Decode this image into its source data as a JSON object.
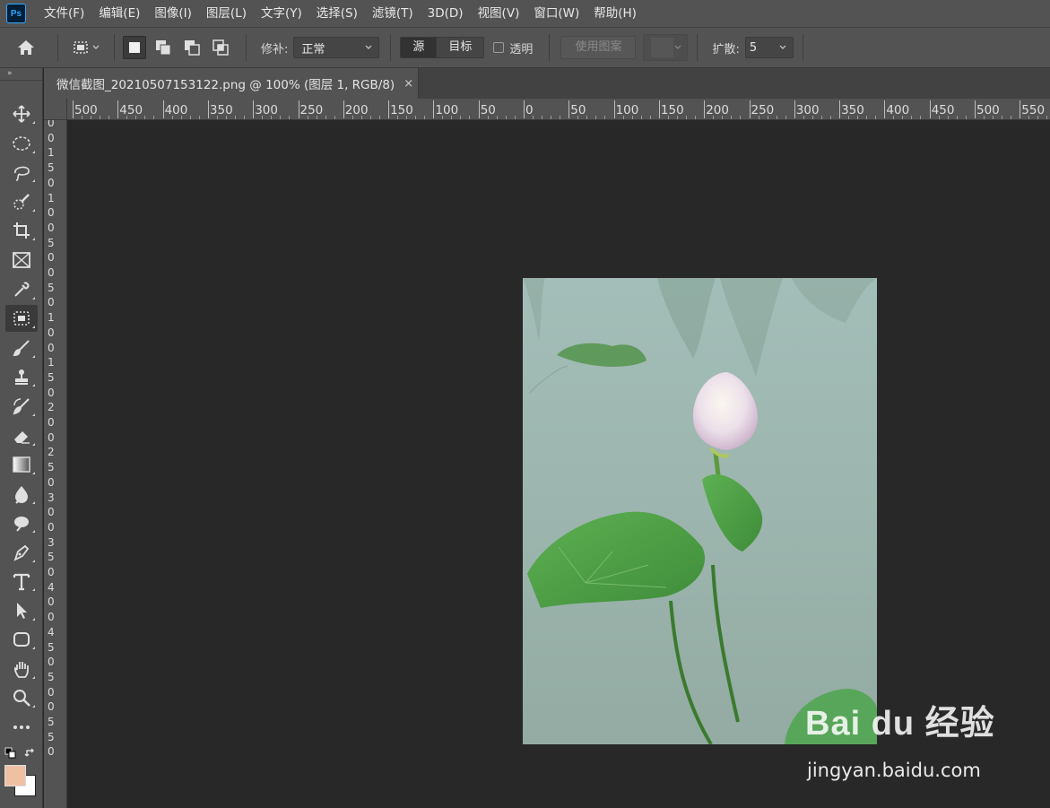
{
  "menubar": {
    "logo": "Ps",
    "items": [
      "文件(F)",
      "编辑(E)",
      "图像(I)",
      "图层(L)",
      "文字(Y)",
      "选择(S)",
      "滤镜(T)",
      "3D(D)",
      "视图(V)",
      "窗口(W)",
      "帮助(H)"
    ]
  },
  "options": {
    "patch_label": "修补:",
    "patch_mode": "正常",
    "source_label": "源",
    "target_label": "目标",
    "transparent_label": "透明",
    "use_pattern_label": "使用图案",
    "diffusion_label": "扩散:",
    "diffusion_value": "5"
  },
  "document": {
    "tab_title": "微信截图_20210507153122.png @ 100% (图层 1, RGB/8)",
    "close_symbol": "×"
  },
  "ruler": {
    "horizontal": [
      "500",
      "450",
      "400",
      "350",
      "300",
      "250",
      "200",
      "150",
      "100",
      "50",
      "0",
      "50",
      "100",
      "150",
      "200",
      "250",
      "300",
      "350",
      "400",
      "450",
      "500",
      "550"
    ],
    "vertical": [
      "0",
      "0",
      "1",
      "5",
      "0",
      "1",
      "0",
      "0",
      "5",
      "0",
      "0",
      "5",
      "0",
      "1",
      "0",
      "0",
      "1",
      "5",
      "0",
      "2",
      "0",
      "0",
      "2",
      "5",
      "0",
      "3",
      "0",
      "0",
      "3",
      "5",
      "0",
      "4",
      "0",
      "0",
      "4",
      "5",
      "0",
      "5",
      "0",
      "0",
      "5",
      "5",
      "0"
    ]
  },
  "tools": [
    "move-tool",
    "elliptical-marquee-tool",
    "lasso-tool",
    "quick-selection-tool",
    "crop-tool",
    "frame-tool",
    "eyedropper-tool",
    "patch-tool",
    "brush-tool",
    "clone-stamp-tool",
    "history-brush-tool",
    "eraser-tool",
    "gradient-tool",
    "blur-tool",
    "dodge-tool",
    "pen-tool",
    "type-tool",
    "path-selection-tool",
    "rectangle-tool",
    "hand-tool",
    "zoom-tool",
    "more-tools"
  ],
  "colors": {
    "foreground": "#f0c0a4",
    "background": "#ffffff",
    "accent": "#31a8ff"
  },
  "watermark": {
    "logo": "Bai du 经验",
    "url": "jingyan.baidu.com"
  }
}
